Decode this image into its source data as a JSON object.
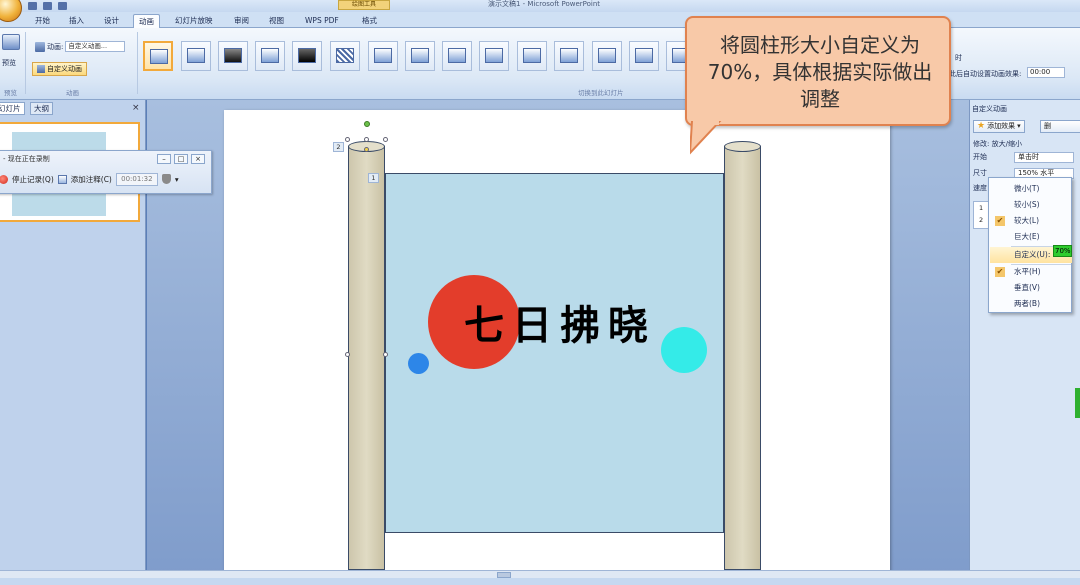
{
  "window": {
    "title": "演示文稿1 - Microsoft PowerPoint",
    "context_tools": "绘图工具"
  },
  "tabs": [
    "开始",
    "插入",
    "设计",
    "动画",
    "幻灯片放映",
    "审阅",
    "视图",
    "WPS PDF",
    "格式"
  ],
  "ribbon": {
    "preview_label": "预览",
    "group_preview": "预览",
    "anim_label": "动画:",
    "anim_value": "自定义动画...",
    "custom_anim_button": "自定义动画",
    "group_anim": "动画",
    "group_transitions": "切换到此幻灯片",
    "time_label": "时",
    "auto_switch_label": "在此后自动设置动画效果:",
    "auto_switch_value": "00:00"
  },
  "left_pane": {
    "tab_slides": "幻灯片",
    "tab_outline": "大纲",
    "close": "×"
  },
  "recording_toolbar": {
    "title": "- 现在正在录制",
    "stop_label": "停止记录(Q)",
    "note_label": "添加注释(C)",
    "time": "00:01:32"
  },
  "slide": {
    "text": "七日拂晓",
    "tag_pillar": "2",
    "tag_body": "1"
  },
  "callout": {
    "text": "将圆柱形大小自定义为70%，具体根据实际做出调整"
  },
  "task_pane": {
    "title": "自定义动画",
    "add_effect": "添加效果",
    "delete": "删",
    "modify_label": "修改: 放大/缩小",
    "start_label": "开始",
    "start_value": "单击时",
    "size_label": "尺寸",
    "size_value": "150% 水平",
    "speed_label": "速度",
    "list_items": [
      "1",
      "2"
    ]
  },
  "size_menu": {
    "items": [
      "微小(T)",
      "较小(S)",
      "较大(L)",
      "巨大(E)",
      "自定义(U):",
      "水平(H)",
      "垂直(V)",
      "两者(B)"
    ],
    "checked": [
      "较大(L)",
      "水平(H)"
    ],
    "highlighted": "自定义(U):",
    "custom_value": "70%"
  },
  "colors": {
    "scroll_body": "#b9dbea",
    "pillar": "#d7d1b9",
    "red_circle": "#e33d2b",
    "cyan_circle": "#34ebe8",
    "blue_circle": "#2d86e8",
    "callout_fill": "#f8c9a8",
    "callout_border": "#e0824f"
  }
}
